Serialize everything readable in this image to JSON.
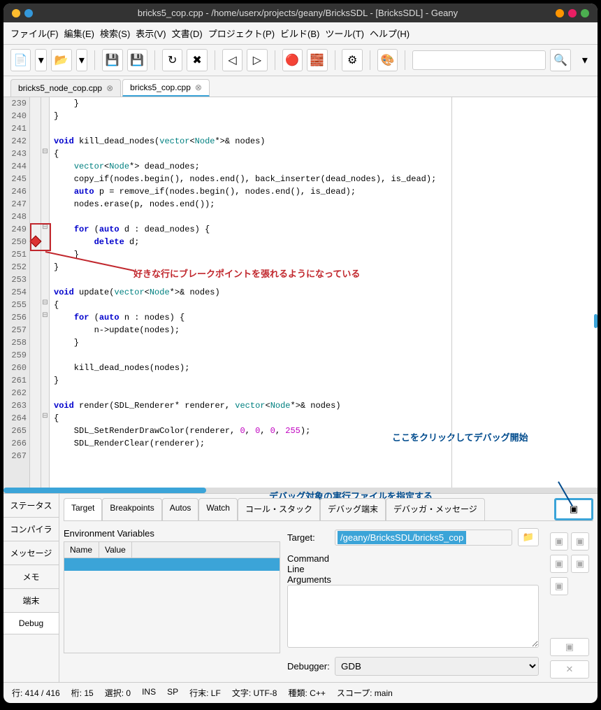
{
  "title": "bricks5_cop.cpp - /home/userx/projects/geany/BricksSDL - [BricksSDL] - Geany",
  "menu": {
    "file": "ファイル(F)",
    "edit": "編集(E)",
    "search": "検索(S)",
    "view": "表示(V)",
    "doc": "文書(D)",
    "project": "プロジェクト(P)",
    "build": "ビルド(B)",
    "tools": "ツール(T)",
    "help": "ヘルプ(H)"
  },
  "tabs": [
    {
      "name": "bricks5_node_cop.cpp"
    },
    {
      "name": "bricks5_cop.cpp"
    }
  ],
  "lines": [
    "239",
    "240",
    "241",
    "242",
    "243",
    "244",
    "245",
    "246",
    "247",
    "248",
    "249",
    "250",
    "251",
    "252",
    "253",
    "254",
    "255",
    "256",
    "257",
    "258",
    "259",
    "260",
    "261",
    "262",
    "263",
    "264",
    "265",
    "266",
    "267"
  ],
  "code": {
    "l242_void": "void",
    "l242_fn": "kill_dead_nodes",
    "l242_vec": "vector",
    "l242_node": "Node",
    "l242_rest": "& nodes)",
    "l244_vec": "vector",
    "l244_node": "Node",
    "l244_rest": " dead_nodes;",
    "l245": "    copy_if(nodes.begin(), nodes.end(), back_inserter(dead_nodes), is_dead);",
    "l246_auto": "auto",
    "l246_rest": " p = remove_if(nodes.begin(), nodes.end(), is_dead);",
    "l247": "    nodes.erase(p, nodes.end());",
    "l249_for": "for",
    "l249_auto": "auto",
    "l249_rest": " d : dead_nodes) {",
    "l250_del": "delete",
    "l250_rest": " d;",
    "l254_void": "void",
    "l254_fn": "update",
    "l254_vec": "vector",
    "l254_node": "Node",
    "l254_rest": "& nodes)",
    "l256_for": "for",
    "l256_auto": "auto",
    "l256_rest": " n : nodes) {",
    "l257": "        n->update(nodes);",
    "l260": "    kill_dead_nodes(nodes);",
    "l263_void": "void",
    "l263_fn": "render",
    "l263_rest1": "(SDL_Renderer* renderer, ",
    "l263_vec": "vector",
    "l263_node": "Node",
    "l263_rest2": "& nodes)",
    "l265_a": "    SDL_SetRenderDrawColor(renderer, ",
    "l265_n0": "0",
    "l265_n255": "255",
    "l265_b": ");",
    "l266": "    SDL_RenderClear(renderer);"
  },
  "annotations": {
    "breakpoint": "好きな行にブレークポイントを張れるようになっている",
    "target": "デバッグ対象の実行ファイルを指定する",
    "run": "ここをクリックしてデバッグ開始"
  },
  "sidetabs": {
    "status": "ステータス",
    "compiler": "コンパイラ",
    "messages": "メッセージ",
    "memo": "メモ",
    "terminal": "端末",
    "debug": "Debug"
  },
  "debugtabs": {
    "target": "Target",
    "breakpoints": "Breakpoints",
    "autos": "Autos",
    "watch": "Watch",
    "callstack": "コール・スタック",
    "debugterm": "デバッグ端末",
    "debugmsg": "デバッガ・メッセージ"
  },
  "debug": {
    "env_label": "Environment Variables",
    "env_name": "Name",
    "env_value": "Value",
    "target_label": "Target:",
    "target_value": "/geany/BricksSDL/bricks5_cop",
    "args_label": "Command Line Arguments",
    "debugger_label": "Debugger:",
    "debugger_value": "GDB"
  },
  "status": {
    "line": "行: 414 / 416",
    "col": "桁: 15",
    "sel": "選択: 0",
    "ins": "INS",
    "sp": "SP",
    "eol": "行末: LF",
    "enc": "文字: UTF-8",
    "type": "種類: C++",
    "scope": "スコープ: main"
  }
}
